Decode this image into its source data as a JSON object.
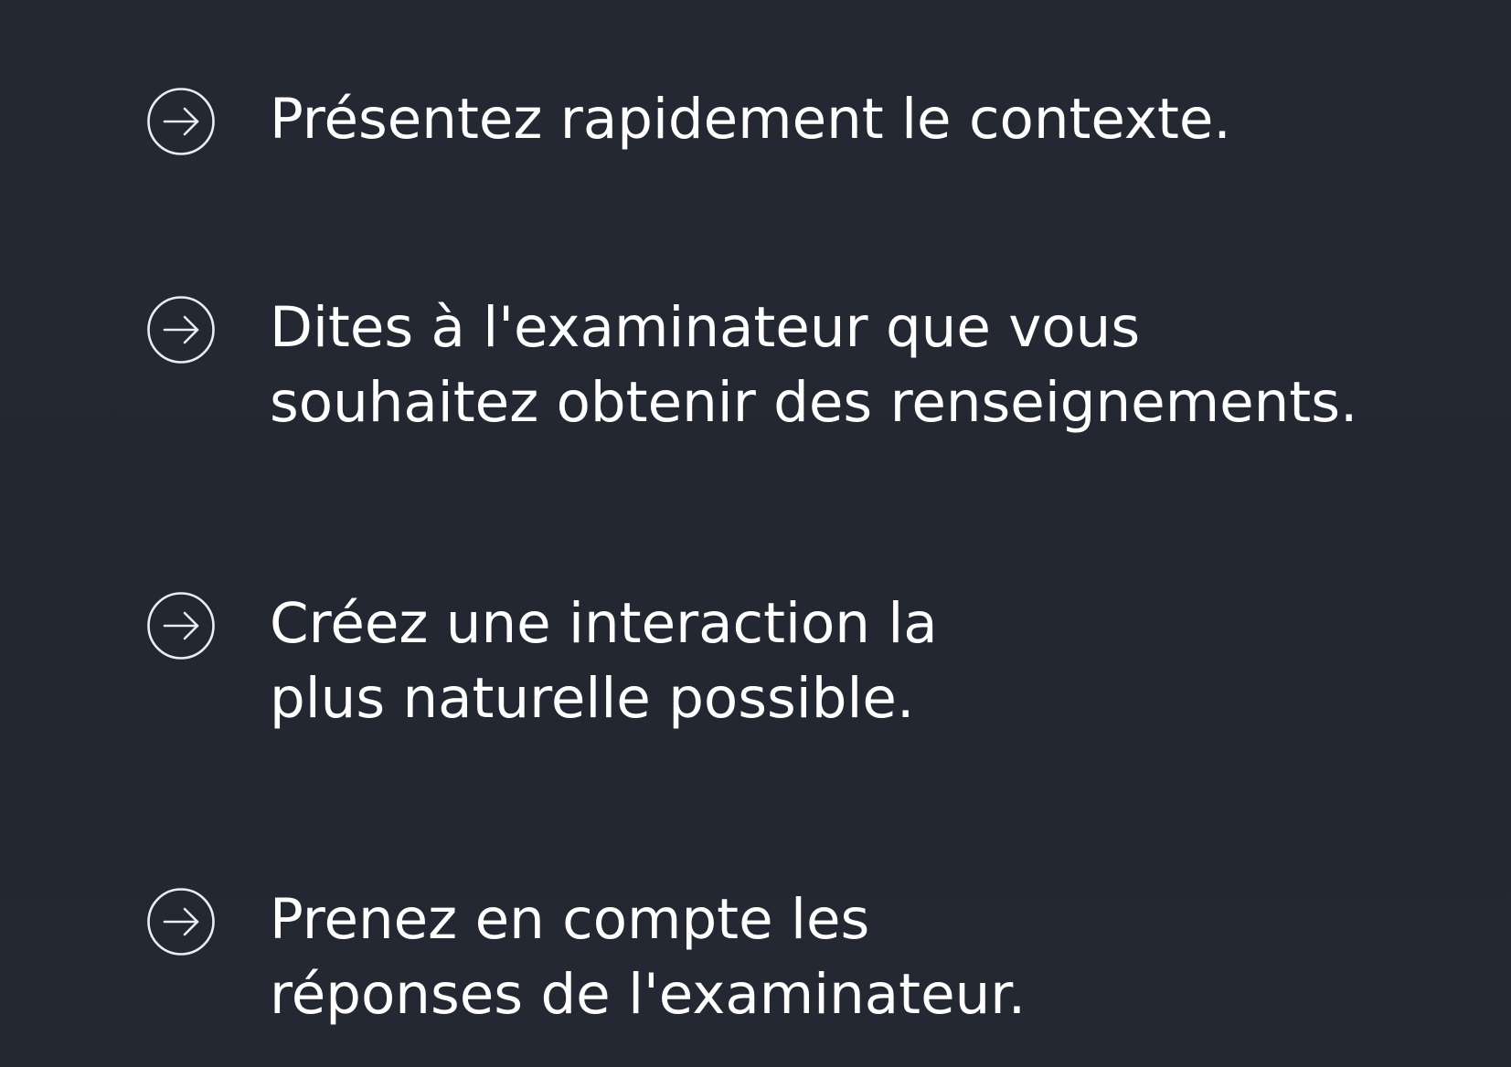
{
  "slide": {
    "background_color": "#232833",
    "text_color": "#ffffff",
    "icon_color": "#e6f0f2",
    "items": [
      {
        "icon": "arrow-right-circle-icon",
        "text": "Présentez rapidement le contexte."
      },
      {
        "icon": "arrow-right-circle-icon",
        "text": "Dites à l'examinateur que vous\nsouhaitez obtenir des renseignements."
      },
      {
        "icon": "arrow-right-circle-icon",
        "text": "Créez une interaction la\nplus naturelle possible."
      },
      {
        "icon": "arrow-right-circle-icon",
        "text": "Prenez en compte les\nréponses de l'examinateur."
      }
    ]
  }
}
